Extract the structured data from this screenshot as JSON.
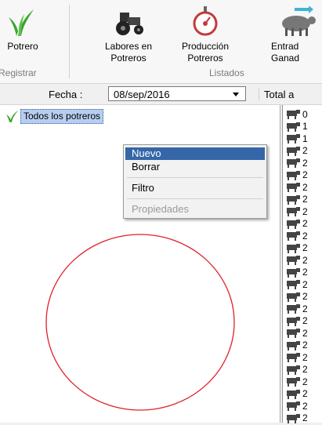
{
  "ribbon": {
    "buttons": [
      {
        "label_line1": "Potrero",
        "label_line2": ""
      },
      {
        "label_line1": "Labores en",
        "label_line2": "Potreros"
      },
      {
        "label_line1": "Producción",
        "label_line2": "Potreros"
      },
      {
        "label_line1": "Entrad",
        "label_line2": "Ganad"
      }
    ],
    "groups": {
      "registrar": "Registrar",
      "listados": "Listados"
    }
  },
  "toolbar": {
    "fecha_label": "Fecha :",
    "fecha_value": "08/sep/2016",
    "total_label": "Total a"
  },
  "tree": {
    "root_label": "Todos los potreros"
  },
  "context_menu": {
    "items": [
      {
        "label": "Nuevo",
        "state": "highlighted"
      },
      {
        "label": "Borrar",
        "state": "enabled"
      },
      {
        "label": "Filtro",
        "state": "enabled"
      },
      {
        "label": "Propiedades",
        "state": "disabled"
      }
    ]
  },
  "animal_list": {
    "rows": [
      "0",
      "1",
      "1",
      "2",
      "2",
      "2",
      "2",
      "2",
      "2",
      "2",
      "2",
      "2",
      "2",
      "2",
      "2",
      "2",
      "2",
      "2",
      "2",
      "2",
      "2",
      "2",
      "2",
      "2",
      "2",
      "2"
    ]
  },
  "colors": {
    "menu_highlight": "#3567a8",
    "selection": "#b8cef0",
    "drawing_circle": "#e0202a",
    "grass_icon": "#3aa52e"
  }
}
